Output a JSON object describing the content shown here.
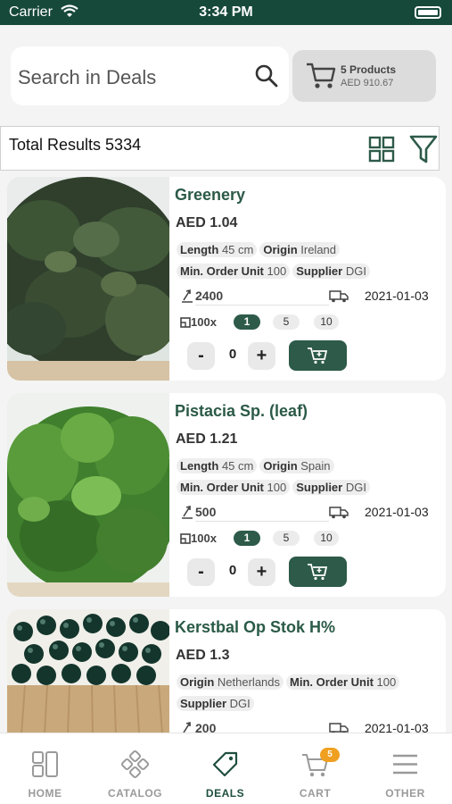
{
  "status_bar": {
    "carrier": "Carrier",
    "time": "3:34 PM"
  },
  "search": {
    "placeholder": "Search in Deals"
  },
  "cart_summary": {
    "count": "5 Products",
    "amount": "AED 910.67"
  },
  "results": {
    "total": "Total Results 5334"
  },
  "products": [
    {
      "name": "Greenery",
      "price": "AED 1.04",
      "rows": [
        [
          {
            "label": "Length",
            "value": "45 cm"
          },
          {
            "label": "Origin",
            "value": "Ireland"
          }
        ],
        [
          {
            "label": "Min. Order Unit",
            "value": "100"
          },
          {
            "label": "Supplier",
            "value": "DGI"
          }
        ]
      ],
      "stock": "2400",
      "date": "2021-01-03",
      "pack_size": "100x",
      "pack_options": [
        "1",
        "5",
        "10"
      ],
      "selected_pack": "1",
      "quantity": "0"
    },
    {
      "name": "Pistacia Sp. (leaf)",
      "price": "AED 1.21",
      "rows": [
        [
          {
            "label": "Length",
            "value": "45 cm"
          },
          {
            "label": "Origin",
            "value": "Spain"
          }
        ],
        [
          {
            "label": "Min. Order Unit",
            "value": "100"
          },
          {
            "label": "Supplier",
            "value": "DGI"
          }
        ]
      ],
      "stock": "500",
      "date": "2021-01-03",
      "pack_size": "100x",
      "pack_options": [
        "1",
        "5",
        "10"
      ],
      "selected_pack": "1",
      "quantity": "0"
    },
    {
      "name": "Kerstbal Op Stok H%",
      "price": "AED 1.3",
      "rows": [
        [
          {
            "label": "Origin",
            "value": "Netherlands"
          },
          {
            "label": "Min. Order Unit",
            "value": "100"
          }
        ],
        [
          {
            "label": "Supplier",
            "value": "DGI"
          }
        ]
      ],
      "stock": "200",
      "date": "2021-01-03"
    }
  ],
  "tabs": [
    {
      "label": "HOME",
      "icon": "home-icon"
    },
    {
      "label": "CATALOG",
      "icon": "catalog-icon"
    },
    {
      "label": "DEALS",
      "icon": "tag-icon",
      "active": true
    },
    {
      "label": "CART",
      "icon": "cart-icon",
      "badge": "5"
    },
    {
      "label": "OTHER",
      "icon": "menu-icon"
    }
  ],
  "colors": {
    "brand": "#17493b",
    "accent": "#2d5a49",
    "badge": "#f0a020"
  }
}
